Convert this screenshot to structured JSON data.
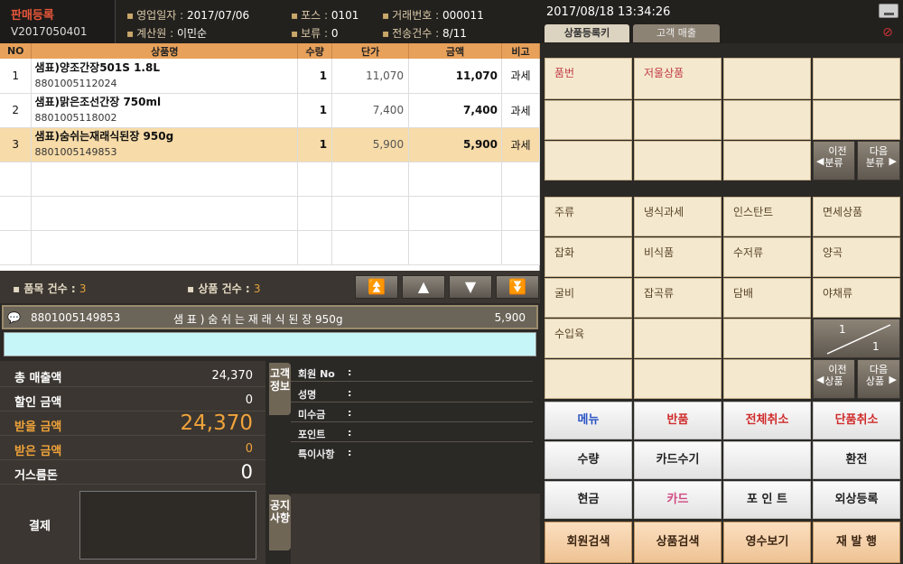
{
  "app": {
    "title": "판매등록",
    "version": "V2017050401"
  },
  "header": {
    "business_date_label": "영업일자",
    "business_date": "2017/07/06",
    "pos_label": "포스",
    "pos": "0101",
    "txn_label": "거래번호",
    "txn": "000011",
    "cashier_label": "계산원",
    "cashier": "이민순",
    "hold_label": "보류",
    "hold": "0",
    "sent_label": "전송건수",
    "sent": "8/11",
    "datetime": "2017/08/18  13:34:26",
    "tabs": [
      "상품등록키",
      "고객 매출"
    ]
  },
  "grid": {
    "columns": [
      "NO",
      "상품명",
      "수량",
      "단가",
      "금액",
      "비고"
    ],
    "rows": [
      {
        "no": "1",
        "name": "샘표)양조간장501S 1.8L",
        "barcode": "8801005112024",
        "qty": "1",
        "price": "11,070",
        "amount": "11,070",
        "tax": "과세"
      },
      {
        "no": "2",
        "name": "샘표)맑은조선간장 750ml",
        "barcode": "8801005118002",
        "qty": "1",
        "price": "7,400",
        "amount": "7,400",
        "tax": "과세"
      },
      {
        "no": "3",
        "name": "샘표)숨쉬는재래식된장 950g",
        "barcode": "8801005149853",
        "qty": "1",
        "price": "5,900",
        "amount": "5,900",
        "tax": "과세"
      }
    ]
  },
  "counts": {
    "item_label": "품목 건수 :",
    "item_count": "3",
    "goods_label": "상품 건수 :",
    "goods_count": "3"
  },
  "scan": {
    "barcode": "8801005149853",
    "name": "샘 표 ) 숨 쉬 는 재 래 식 된 장  950g",
    "price": "5,900"
  },
  "totals": {
    "total_sales_label": "총 매출액",
    "total_sales": "24,370",
    "discount_label": "할인 금액",
    "discount": "0",
    "due_label": "받을 금액",
    "due": "24,370",
    "received_label": "받은 금액",
    "received": "0",
    "change_label": "거스름돈",
    "change": "0",
    "payment_label": "결제"
  },
  "customer": {
    "tab_label": "고객정보",
    "fields": [
      {
        "label": "회원 No",
        "value": ":"
      },
      {
        "label": "성명",
        "value": ":"
      },
      {
        "label": "미수금",
        "value": ":"
      },
      {
        "label": "포인트",
        "value": ":"
      },
      {
        "label": "특이사항",
        "value": ":"
      }
    ],
    "notice_label": "공지사항"
  },
  "keys": {
    "top": [
      "품번",
      "저울상품"
    ],
    "prev_cat": "이전\n분류",
    "next_cat": "다음\n분류",
    "categories": [
      "주류",
      "냉식과세",
      "인스탄트",
      "면세상품",
      "잡화",
      "비식품",
      "수저류",
      "양곡",
      "굴비",
      "잡곡류",
      "담배",
      "야채류",
      "수입육"
    ],
    "page": {
      "current": "1",
      "total": "1"
    },
    "prev_item": "이전\n상품",
    "next_item": "다음\n상품"
  },
  "functions": {
    "row1": [
      "메뉴",
      "반품",
      "전체취소",
      "단품취소"
    ],
    "row2": [
      "수량",
      "카드수기",
      "",
      "환전"
    ],
    "row3": [
      "현금",
      "카드",
      "포 인 트",
      "외상등록"
    ],
    "row4": [
      "회원검색",
      "상품검색",
      "영수보기",
      "재 발 행"
    ]
  },
  "colors": {
    "accent": "#e8a15a",
    "due": "#f1a33a",
    "selected_row": "#f7dba8",
    "scan_bg": "#c7f6f9"
  }
}
